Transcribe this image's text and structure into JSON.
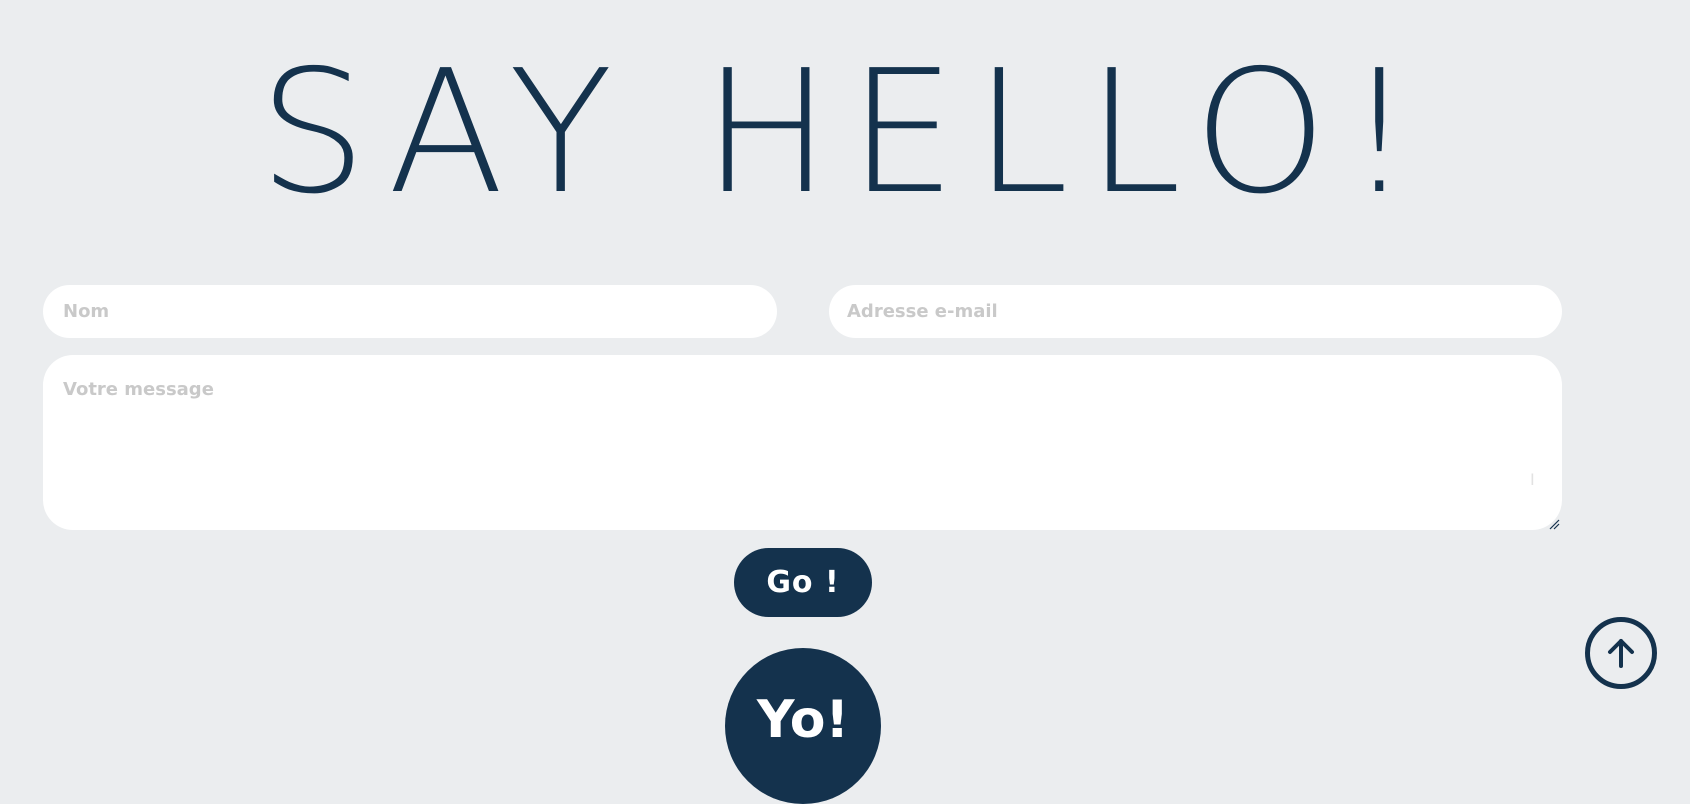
{
  "hero": {
    "title": "SAY HELLO!"
  },
  "form": {
    "name_placeholder": "Nom",
    "email_placeholder": "Adresse e-mail",
    "message_placeholder": "Votre message",
    "submit_label": "Go !"
  },
  "badge": {
    "text": "Yo!"
  },
  "icons": {
    "scroll_top": "arrow-up-icon",
    "resize": "resize-handle-icon"
  },
  "colors": {
    "background": "#ebedef",
    "accent": "#14324d",
    "placeholder": "#c9c9c9",
    "field_background": "#ffffff"
  }
}
